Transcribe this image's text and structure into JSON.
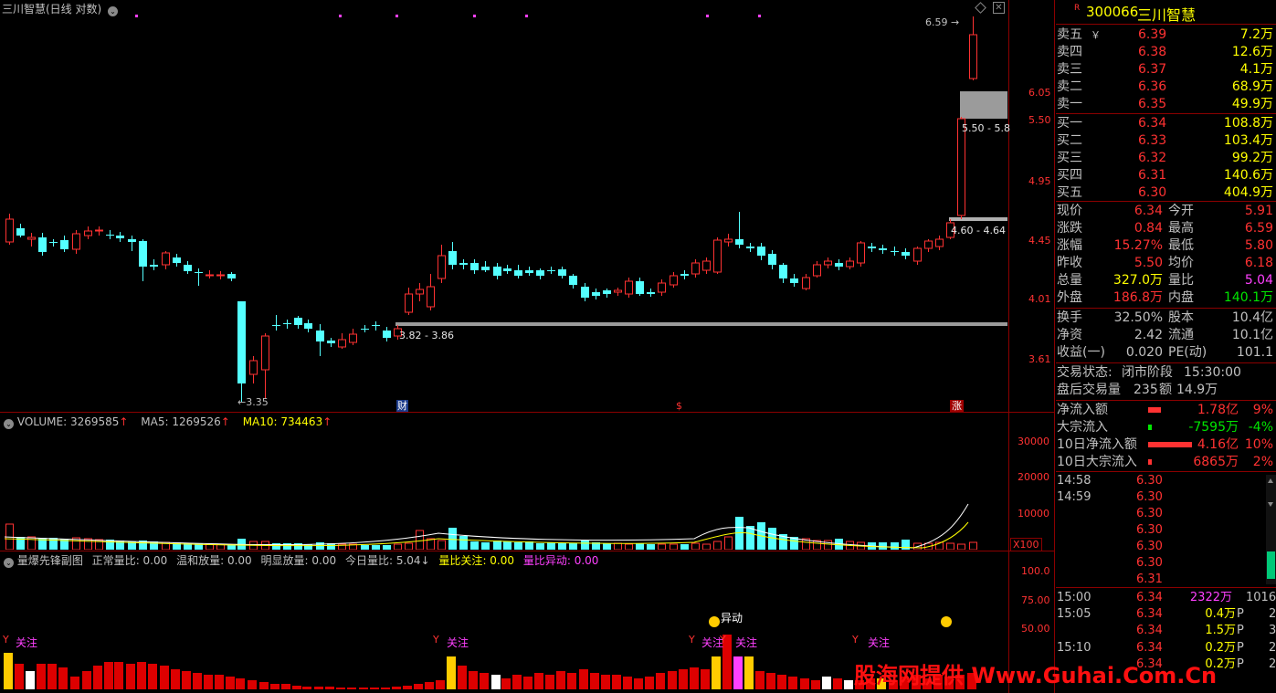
{
  "main_panel": {
    "title": "三川智慧(日线 对数)",
    "price_axis": [
      "6.05",
      "5.50",
      "4.95",
      "4.45",
      "4.01",
      "3.61"
    ],
    "high_label": "6.59",
    "low_label": "3.35",
    "gap_labels": [
      "5.50 - 5.8",
      "4.60 - 4.64",
      "3.82 - 3.86"
    ],
    "event_markers": [
      "财",
      "$",
      "涨"
    ]
  },
  "volume_panel": {
    "name": "VOLUME",
    "value": "3269585",
    "ma5_label": "MA5",
    "ma5_value": "1269526",
    "ma10_label": "MA10",
    "ma10_value": "734463",
    "axis": [
      "30000",
      "20000",
      "10000"
    ],
    "unit": "X100"
  },
  "indicator_panel": {
    "name": "量爆先锋副图",
    "items": [
      {
        "label": "正常量比",
        "value": "0.00"
      },
      {
        "label": "温和放量",
        "value": "0.00"
      },
      {
        "label": "明显放量",
        "value": "0.00"
      },
      {
        "label": "今日量比",
        "value": "5.04"
      },
      {
        "label": "量比关注",
        "value": "0.00"
      },
      {
        "label": "量比异动",
        "value": "0.00"
      }
    ],
    "axis": [
      "100.0",
      "75.00",
      "50.00"
    ],
    "focus_label": "关注",
    "anomaly_label": "异动"
  },
  "quote": {
    "code": "300066",
    "name": "三川智慧",
    "flag": "R",
    "asks": [
      {
        "label": "卖五",
        "price": "6.39",
        "vol": "7.2万",
        "mark": "￥"
      },
      {
        "label": "卖四",
        "price": "6.38",
        "vol": "12.6万"
      },
      {
        "label": "卖三",
        "price": "6.37",
        "vol": "4.1万"
      },
      {
        "label": "卖二",
        "price": "6.36",
        "vol": "68.9万"
      },
      {
        "label": "卖一",
        "price": "6.35",
        "vol": "49.9万"
      }
    ],
    "bids": [
      {
        "label": "买一",
        "price": "6.34",
        "vol": "108.8万"
      },
      {
        "label": "买二",
        "price": "6.33",
        "vol": "103.4万"
      },
      {
        "label": "买三",
        "price": "6.32",
        "vol": "99.2万"
      },
      {
        "label": "买四",
        "price": "6.31",
        "vol": "140.6万"
      },
      {
        "label": "买五",
        "price": "6.30",
        "vol": "404.9万"
      }
    ],
    "stats": [
      {
        "l1": "现价",
        "v1": "6.34",
        "l2": "今开",
        "v2": "5.91"
      },
      {
        "l1": "涨跌",
        "v1": "0.84",
        "l2": "最高",
        "v2": "6.59"
      },
      {
        "l1": "涨幅",
        "v1": "15.27%",
        "l2": "最低",
        "v2": "5.80"
      },
      {
        "l1": "昨收",
        "v1": "5.50",
        "l2": "均价",
        "v2": "6.18"
      },
      {
        "l1": "总量",
        "v1": "327.0万",
        "l2": "量比",
        "v2": "5.04"
      },
      {
        "l1": "外盘",
        "v1": "186.8万",
        "l2": "内盘",
        "v2": "140.1万"
      }
    ],
    "stats2": [
      {
        "l1": "换手",
        "v1": "32.50%",
        "l2": "股本",
        "v2": "10.4亿"
      },
      {
        "l1": "净资",
        "v1": "2.42",
        "l2": "流通",
        "v2": "10.1亿"
      },
      {
        "l1": "收益(一)",
        "v1": "0.020",
        "l2": "PE(动)",
        "v2": "101.1"
      }
    ],
    "trade_status_label": "交易状态:",
    "trade_status": "闭市阶段",
    "trade_time": "15:30:00",
    "after_hours_label": "盘后交易量",
    "after_hours_vol": "235",
    "after_hours_amt_label": "额",
    "after_hours_amt": "14.9万",
    "flows": [
      {
        "label": "净流入额",
        "value": "1.78亿",
        "pct": "9%",
        "bar": 0.09,
        "color": "#ff3232"
      },
      {
        "label": "大宗流入",
        "value": "-7595万",
        "pct": "-4%",
        "bar": 0.02,
        "color": "#00e600"
      },
      {
        "label": "10日净流入额",
        "value": "4.16亿",
        "pct": "10%",
        "bar": 0.3,
        "color": "#ff3232"
      },
      {
        "label": "10日大宗流入",
        "value": "6865万",
        "pct": "2%",
        "bar": 0.02,
        "color": "#ff3232"
      }
    ],
    "ticks": [
      {
        "time": "14:58",
        "price": "6.30",
        "vol": "",
        "type": "",
        "n": ""
      },
      {
        "time": "14:59",
        "price": "6.30",
        "vol": "",
        "type": "",
        "n": ""
      },
      {
        "time": "",
        "price": "6.30",
        "vol": "",
        "type": "",
        "n": ""
      },
      {
        "time": "",
        "price": "6.30",
        "vol": "",
        "type": "",
        "n": ""
      },
      {
        "time": "",
        "price": "6.30",
        "vol": "",
        "type": "",
        "n": ""
      },
      {
        "time": "",
        "price": "6.30",
        "vol": "",
        "type": "",
        "n": ""
      },
      {
        "time": "",
        "price": "6.31",
        "vol": "",
        "type": "",
        "n": ""
      },
      {
        "time": "15:00",
        "price": "6.34",
        "vol": "2322万",
        "type": "",
        "n": "1016"
      },
      {
        "time": "15:05",
        "price": "6.34",
        "vol": "0.4万",
        "type": "P",
        "n": "2"
      },
      {
        "time": "",
        "price": "6.34",
        "vol": "1.5万",
        "type": "P",
        "n": "3"
      },
      {
        "time": "15:10",
        "price": "6.34",
        "vol": "0.2万",
        "type": "P",
        "n": "2"
      },
      {
        "time": "",
        "price": "6.34",
        "vol": "0.2万",
        "type": "P",
        "n": "2"
      }
    ]
  },
  "watermark": "股海网提供 Www.Guhai.Com.Cn"
}
